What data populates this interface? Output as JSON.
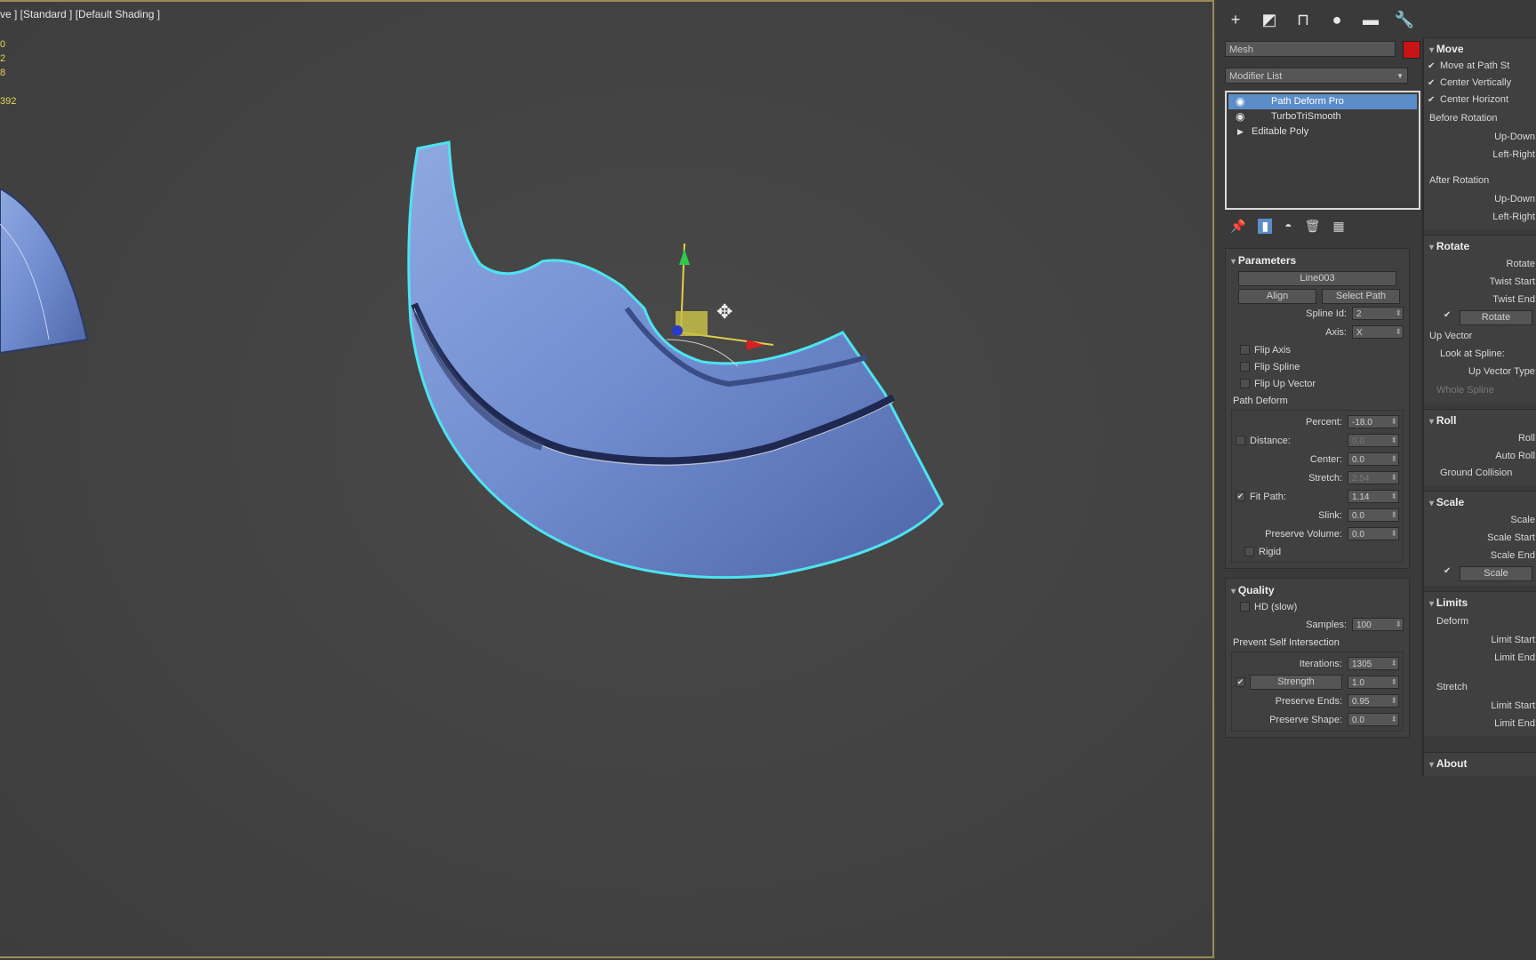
{
  "viewport": {
    "label": "ve ] [Standard ] [Default Shading ]",
    "stats": [
      "0",
      "2",
      "8",
      "",
      "392"
    ]
  },
  "toolbar": {
    "icons": [
      "plus-icon",
      "curve-icon",
      "hierarchy-icon",
      "motion-icon",
      "display-icon",
      "wrench-icon"
    ],
    "glyphs": [
      "+",
      "◩",
      "⊓",
      "●",
      "▬",
      "🔧"
    ]
  },
  "object": {
    "name": "Mesh",
    "color": "#c81414"
  },
  "modifier_list": {
    "label": "Modifier List"
  },
  "stack": [
    {
      "label": "Path Deform Pro",
      "selected": true
    },
    {
      "label": "TurboTriSmooth",
      "selected": false
    },
    {
      "label": "Editable Poly",
      "selected": false
    }
  ],
  "parameters": {
    "title": "Parameters",
    "path_name": "Line003",
    "align_label": "Align",
    "select_path_label": "Select Path",
    "spline_id_label": "Spline Id:",
    "spline_id": "2",
    "axis_label": "Axis:",
    "axis": "X",
    "flip_axis": "Flip Axis",
    "flip_spline": "Flip Spline",
    "flip_up_vector": "Flip Up Vector",
    "path_deform_head": "Path Deform",
    "percent_label": "Percent:",
    "percent": "-18.0",
    "distance_label": "Distance:",
    "distance": "0.0",
    "center_label": "Center:",
    "center": "0.0",
    "stretch_label": "Stretch:",
    "stretch": "2.54",
    "fit_path_label": "Fit Path:",
    "fit_path": "1.14",
    "slink_label": "Slink:",
    "slink": "0.0",
    "preserve_volume_label": "Preserve Volume:",
    "preserve_volume": "0.0",
    "rigid": "Rigid"
  },
  "quality": {
    "title": "Quality",
    "hd": "HD (slow)",
    "samples_label": "Samples:",
    "samples": "100",
    "psi_head": "Prevent Self Intersection",
    "iterations_label": "Iterations:",
    "iterations": "1305",
    "strength_label": "Strength",
    "strength": "1.0",
    "preserve_ends_label": "Preserve Ends:",
    "preserve_ends": "0.95",
    "preserve_shape_label": "Preserve Shape:",
    "preserve_shape": "0.0"
  },
  "right": {
    "move": {
      "title": "Move",
      "move_at_path": "Move at Path St",
      "center_vert": "Center Vertically",
      "center_horiz": "Center Horizont",
      "before_rotation": "Before Rotation",
      "up_down": "Up-Down:",
      "left_right": "Left-Right:",
      "after_rotation": "After Rotation",
      "up_down2": "Up-Down:",
      "left_right2": "Left-Right:"
    },
    "rotate": {
      "title": "Rotate",
      "rotate_label": "Rotate:",
      "twist_start": "Twist Start:",
      "twist_end": "Twist End:",
      "rotate_btn": "Rotate",
      "up_vector": "Up Vector",
      "look_at_spline": "Look at Spline:",
      "up_vector_type": "Up Vector Type:",
      "whole_spline": "Whole Spline"
    },
    "roll": {
      "title": "Roll",
      "roll_label": "Roll:",
      "auto_roll": "Auto Roll:",
      "ground_collision": "Ground Collision"
    },
    "scale": {
      "title": "Scale",
      "scale_label": "Scale:",
      "scale_start": "Scale Start:",
      "scale_end": "Scale End:",
      "scale_btn": "Scale"
    },
    "limits": {
      "title": "Limits",
      "deform": "Deform",
      "limit_start": "Limit Start:",
      "limit_end": "Limit End:",
      "stretch": "Stretch",
      "limit_start2": "Limit Start:",
      "limit_end2": "Limit End:"
    },
    "about": {
      "title": "About"
    }
  }
}
